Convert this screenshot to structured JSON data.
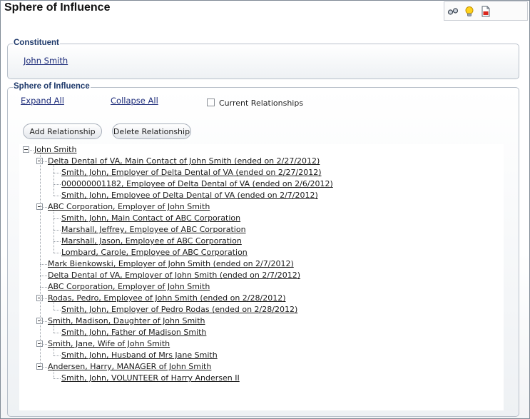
{
  "title": "Sphere of Influence",
  "toolbar": {
    "icons": [
      "glasses-icon",
      "lightbulb-icon",
      "pdf-icon"
    ]
  },
  "constituent": {
    "legend": "Constituent",
    "name": "John Smith"
  },
  "sphere": {
    "legend": "Sphere of Influence",
    "expand_all": "Expand All",
    "collapse_all": "Collapse All",
    "current_relationships": "Current Relationships",
    "add_relationship": "Add Relationship",
    "delete_relationship": "Delete Relationship"
  },
  "tree": {
    "root": "John Smith",
    "nodes": [
      {
        "label": "Delta Dental of VA, Main Contact of John Smith (ended on 2/27/2012)",
        "children": [
          "Smith, John, Employer of Delta Dental of VA (ended on 2/27/2012)",
          "000000001182, Employee of Delta Dental of VA (ended on 2/6/2012)",
          "Smith, John, Employee of Delta Dental of VA (ended on 2/7/2012)"
        ]
      },
      {
        "label": "ABC Corporation, Employer of John Smith",
        "children": [
          "Smith, John, Main Contact of ABC Corporation",
          "Marshall, Jeffrey, Employee of ABC Corporation",
          "Marshall, Jason, Employee of ABC Corporation",
          "Lombard, Carole, Employee of ABC Corporation"
        ]
      },
      {
        "label": "Mark Bienkowski, Employer of John Smith (ended on 2/7/2012)",
        "children": []
      },
      {
        "label": "Delta Dental of VA, Employer of John Smith (ended on 2/7/2012)",
        "children": []
      },
      {
        "label": "ABC Corporation, Employer of John Smith",
        "children": []
      },
      {
        "label": "Rodas, Pedro, Employee of John Smith (ended on 2/28/2012)",
        "children": [
          "Smith, John, Employer of Pedro Rodas (ended on 2/28/2012)"
        ]
      },
      {
        "label": "Smith, Madison, Daughter of John Smith",
        "children": [
          "Smith, John, Father of Madison Smith"
        ]
      },
      {
        "label": "Smith, Jane, Wife of John Smith",
        "children": [
          "Smith, John, Husband of Mrs Jane Smith"
        ]
      },
      {
        "label": "Andersen, Harry, MANAGER of John Smith",
        "children": [
          "Smith, John, VOLUNTEER of Harry Andersen II"
        ]
      }
    ]
  }
}
